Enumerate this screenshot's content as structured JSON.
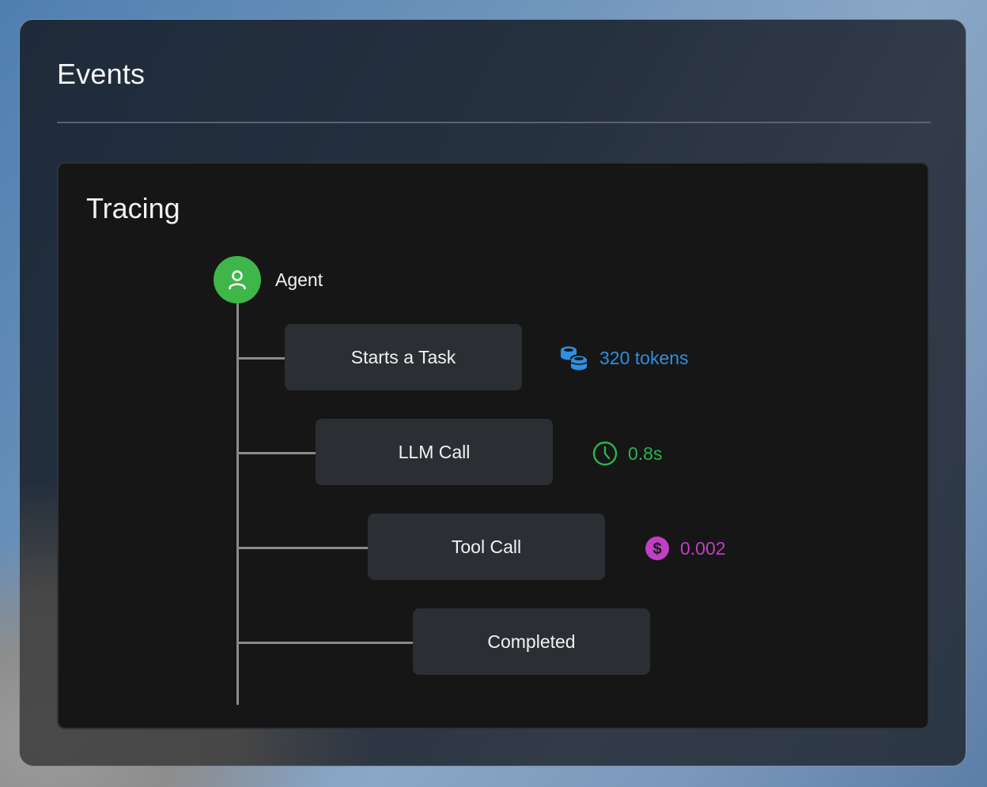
{
  "window": {
    "title": "Events"
  },
  "tracing": {
    "title": "Tracing",
    "root": {
      "label": "Agent",
      "icon": "user-icon",
      "color": "#3fb649"
    },
    "steps": [
      {
        "label": "Starts a Task",
        "metric": {
          "value": "320 tokens",
          "icon": "coins-icon",
          "color": "#2f8fe0"
        }
      },
      {
        "label": "LLM Call",
        "metric": {
          "value": "0.8s",
          "icon": "clock-icon",
          "color": "#2db24e"
        }
      },
      {
        "label": "Tool Call",
        "metric": {
          "value": "0.002",
          "icon": "dollar-icon",
          "color": "#c03fc2"
        }
      },
      {
        "label": "Completed"
      }
    ]
  }
}
